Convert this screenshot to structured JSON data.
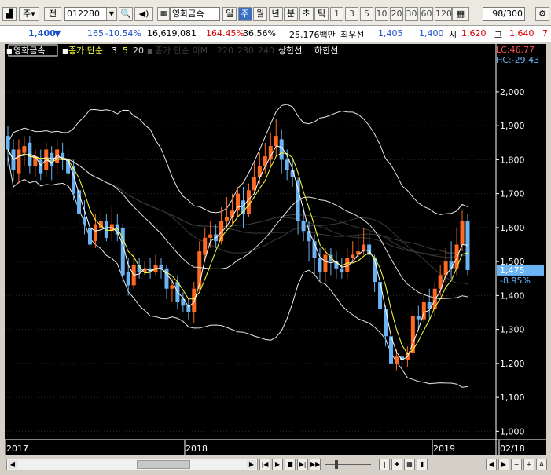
{
  "toolbar": {
    "type_label": "주",
    "prev_label": "전",
    "code": "012280",
    "stock_name": "영화금속",
    "periods": [
      "일",
      "주",
      "월",
      "년",
      "분",
      "초",
      "틱"
    ],
    "active_period": "주",
    "intervals": [
      "1",
      "3",
      "5",
      "10",
      "20",
      "30",
      "60",
      "120"
    ],
    "count": "98/300"
  },
  "quote": {
    "price": "1,400",
    "change": "165",
    "change_pct": "-10.54%",
    "volume": "16,619,081",
    "vol_ratio": "164.45%",
    "turnover": "36.56%",
    "amount": "25,176백만",
    "first_label": "최우선",
    "bid": "1,405",
    "ask": "1,400",
    "open_label": "시",
    "open": "1,620",
    "high_label": "고",
    "high": "1,640",
    "extra": "7"
  },
  "legend": {
    "name": "영화금속",
    "ma_label": "종가 단순",
    "ma_periods": [
      "3",
      "5",
      "20"
    ],
    "vol_ma_label": "종가 단순 이M",
    "vol_ma_periods": [
      "220",
      "230",
      "240"
    ],
    "upper_limit": "상한선",
    "lower_limit": "하한선"
  },
  "indicators": {
    "lc": "LC:46.77",
    "hc": "HC:-29.43",
    "current_price": "1,475",
    "current_pct": "-8.95%"
  },
  "colors": {
    "up": "#ff6a20",
    "down": "#6ab4f4",
    "ma3": "#ffffff",
    "ma5": "#ffff40",
    "ma20": "#e0e0e0",
    "axis": "#ffffff",
    "grid": "#2b2b2b"
  },
  "chart_data": {
    "type": "candlestick",
    "y_range": [
      980,
      2090
    ],
    "y_ticks": [
      "2,000",
      "1,900",
      "1,800",
      "1,700",
      "1,600",
      "1,500",
      "1,400",
      "1,300",
      "1,200",
      "1,100",
      "1,000"
    ],
    "x_labels": [
      "2017",
      "2018",
      "2019",
      "02/18"
    ],
    "candles": [
      [
        1870,
        1830,
        1900,
        1780
      ],
      [
        1830,
        1770,
        1860,
        1740
      ],
      [
        1760,
        1830,
        1860,
        1730
      ],
      [
        1820,
        1840,
        1870,
        1780
      ],
      [
        1850,
        1780,
        1870,
        1760
      ],
      [
        1780,
        1810,
        1830,
        1750
      ],
      [
        1800,
        1760,
        1830,
        1740
      ],
      [
        1770,
        1830,
        1850,
        1750
      ],
      [
        1820,
        1780,
        1840,
        1740
      ],
      [
        1790,
        1830,
        1860,
        1760
      ],
      [
        1820,
        1800,
        1850,
        1770
      ],
      [
        1800,
        1760,
        1830,
        1740
      ],
      [
        1780,
        1700,
        1800,
        1680
      ],
      [
        1710,
        1640,
        1730,
        1600
      ],
      [
        1630,
        1610,
        1680,
        1580
      ],
      [
        1600,
        1550,
        1620,
        1530
      ],
      [
        1560,
        1610,
        1640,
        1540
      ],
      [
        1600,
        1620,
        1650,
        1570
      ],
      [
        1620,
        1570,
        1640,
        1560
      ],
      [
        1590,
        1610,
        1660,
        1560
      ],
      [
        1610,
        1580,
        1640,
        1560
      ],
      [
        1600,
        1460,
        1610,
        1440
      ],
      [
        1470,
        1430,
        1510,
        1400
      ],
      [
        1430,
        1490,
        1520,
        1420
      ],
      [
        1490,
        1470,
        1510,
        1450
      ],
      [
        1470,
        1480,
        1500,
        1460
      ],
      [
        1480,
        1470,
        1510,
        1450
      ],
      [
        1470,
        1490,
        1520,
        1460
      ],
      [
        1490,
        1480,
        1510,
        1450
      ],
      [
        1480,
        1420,
        1490,
        1390
      ],
      [
        1420,
        1430,
        1450,
        1380
      ],
      [
        1440,
        1380,
        1460,
        1360
      ],
      [
        1390,
        1370,
        1410,
        1350
      ],
      [
        1370,
        1350,
        1390,
        1330
      ],
      [
        1350,
        1420,
        1440,
        1320
      ],
      [
        1420,
        1530,
        1560,
        1410
      ],
      [
        1520,
        1570,
        1600,
        1500
      ],
      [
        1570,
        1580,
        1620,
        1540
      ],
      [
        1580,
        1560,
        1610,
        1540
      ],
      [
        1560,
        1620,
        1660,
        1550
      ],
      [
        1620,
        1630,
        1690,
        1600
      ],
      [
        1630,
        1650,
        1700,
        1610
      ],
      [
        1650,
        1700,
        1720,
        1630
      ],
      [
        1680,
        1640,
        1720,
        1600
      ],
      [
        1640,
        1710,
        1730,
        1630
      ],
      [
        1710,
        1750,
        1790,
        1700
      ],
      [
        1750,
        1780,
        1820,
        1730
      ],
      [
        1780,
        1810,
        1850,
        1760
      ],
      [
        1800,
        1840,
        1880,
        1780
      ],
      [
        1840,
        1870,
        1920,
        1810
      ],
      [
        1860,
        1800,
        1890,
        1760
      ],
      [
        1800,
        1770,
        1830,
        1740
      ],
      [
        1770,
        1750,
        1800,
        1720
      ],
      [
        1740,
        1620,
        1750,
        1580
      ],
      [
        1620,
        1590,
        1660,
        1560
      ],
      [
        1590,
        1560,
        1620,
        1500
      ],
      [
        1560,
        1510,
        1580,
        1460
      ],
      [
        1510,
        1470,
        1540,
        1440
      ],
      [
        1470,
        1520,
        1540,
        1440
      ],
      [
        1520,
        1500,
        1540,
        1460
      ],
      [
        1500,
        1480,
        1530,
        1450
      ],
      [
        1480,
        1470,
        1510,
        1450
      ],
      [
        1470,
        1510,
        1540,
        1450
      ],
      [
        1510,
        1520,
        1560,
        1500
      ],
      [
        1520,
        1530,
        1580,
        1500
      ],
      [
        1530,
        1550,
        1600,
        1520
      ],
      [
        1550,
        1520,
        1590,
        1500
      ],
      [
        1510,
        1440,
        1520,
        1410
      ],
      [
        1440,
        1360,
        1450,
        1340
      ],
      [
        1360,
        1280,
        1370,
        1250
      ],
      [
        1280,
        1200,
        1300,
        1170
      ],
      [
        1200,
        1220,
        1240,
        1180
      ],
      [
        1220,
        1210,
        1240,
        1190
      ],
      [
        1210,
        1230,
        1250,
        1190
      ],
      [
        1230,
        1340,
        1360,
        1220
      ],
      [
        1340,
        1330,
        1370,
        1300
      ],
      [
        1330,
        1380,
        1400,
        1320
      ],
      [
        1380,
        1360,
        1420,
        1330
      ],
      [
        1360,
        1420,
        1440,
        1340
      ],
      [
        1420,
        1460,
        1490,
        1400
      ],
      [
        1460,
        1500,
        1540,
        1440
      ],
      [
        1500,
        1480,
        1560,
        1450
      ],
      [
        1480,
        1550,
        1600,
        1460
      ],
      [
        1550,
        1620,
        1650,
        1530
      ],
      [
        1620,
        1475,
        1640,
        1460
      ]
    ]
  }
}
